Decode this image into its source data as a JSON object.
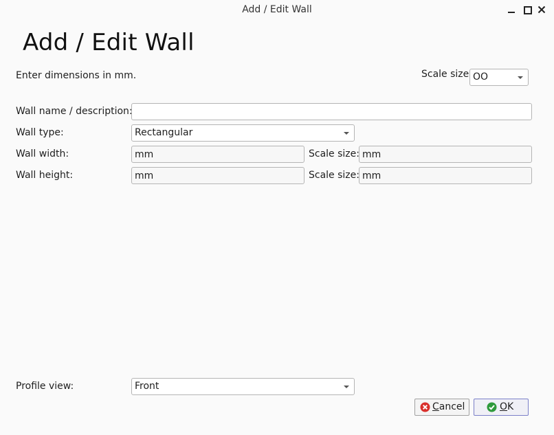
{
  "window": {
    "title": "Add / Edit Wall"
  },
  "heading": "Add / Edit Wall",
  "hint": "Enter dimensions in mm.",
  "scale_size": {
    "label": "Scale size",
    "value": "OO"
  },
  "form": {
    "wall_name": {
      "label": "Wall name / description:",
      "value": ""
    },
    "wall_type": {
      "label": "Wall type:",
      "value": "Rectangular"
    },
    "wall_width": {
      "label": "Wall width:",
      "value": "mm",
      "scale_label": "Scale size:",
      "scale_value": "mm"
    },
    "wall_height": {
      "label": "Wall height:",
      "value": "mm",
      "scale_label": "Scale size:",
      "scale_value": "mm"
    },
    "profile_view": {
      "label": "Profile view:",
      "value": "Front"
    }
  },
  "buttons": {
    "cancel": "Cancel",
    "ok": "OK"
  },
  "icons": {
    "cancel": "cancel-icon",
    "ok": "ok-check-icon",
    "minimize": "minimize-icon",
    "maximize": "maximize-icon",
    "close": "close-icon"
  },
  "colors": {
    "cancel_icon": "#d9302c",
    "ok_icon": "#2f9a3c",
    "default_button_border": "#7a7fc8"
  }
}
